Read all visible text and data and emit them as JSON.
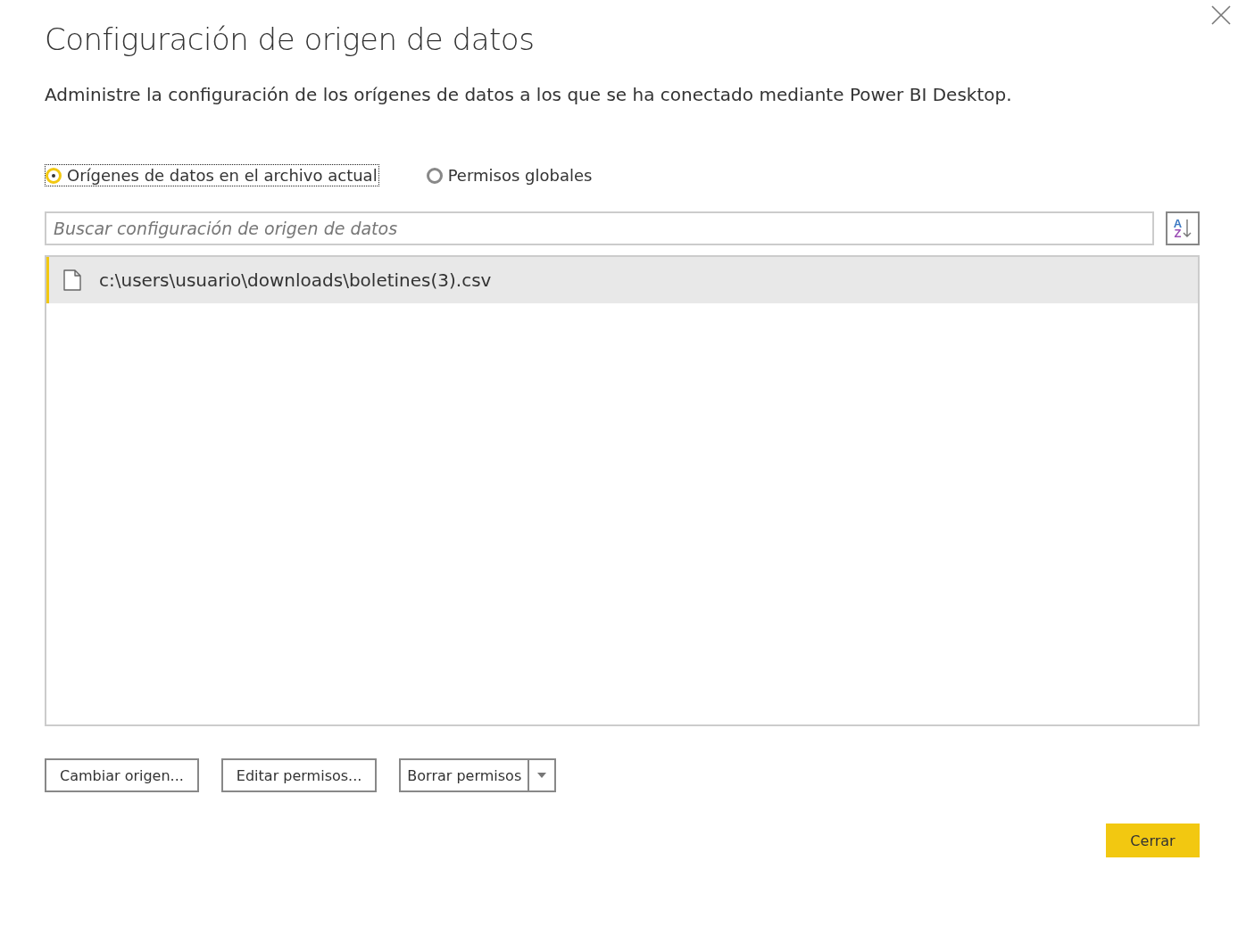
{
  "title": "Configuración de origen de datos",
  "description": "Administre la configuración de los orígenes de datos a los que se ha conectado mediante Power BI Desktop.",
  "scope_options": [
    {
      "label": "Orígenes de datos en el archivo actual",
      "selected": true
    },
    {
      "label": "Permisos globales",
      "selected": false
    }
  ],
  "search": {
    "placeholder": "Buscar configuración de origen de datos"
  },
  "sort_button": {
    "letters": [
      "A",
      "Z"
    ]
  },
  "sources": [
    {
      "path": "c:\\users\\usuario\\downloads\\boletines(3).csv",
      "selected": true
    }
  ],
  "actions": [
    {
      "label": "Cambiar origen...",
      "kind": "plain"
    },
    {
      "label": "Editar permisos...",
      "kind": "plain"
    },
    {
      "label": "Borrar permisos",
      "kind": "split"
    }
  ],
  "close_button": "Cerrar"
}
